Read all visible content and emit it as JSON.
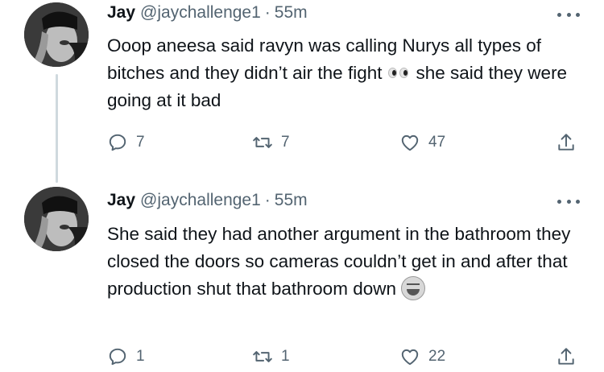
{
  "tweets": [
    {
      "author": {
        "name": "Jay",
        "handle": "@jaychallenge1"
      },
      "separator": "·",
      "time": "55m",
      "text_before_emoji": "Ooop aneesa said ravyn was calling Nurys all types of bitches and they didn’t air the fight",
      "emoji": "eyes-emoji",
      "text_after_emoji": "she said they were going at it bad",
      "stats": {
        "replies": "7",
        "retweets": "7",
        "likes": "47"
      }
    },
    {
      "author": {
        "name": "Jay",
        "handle": "@jaychallenge1"
      },
      "separator": "·",
      "time": "55m",
      "text_before_emoji": "She said they had another argument in the bathroom they closed the doors so cameras couldn’t get in and after that production shut that bathroom down",
      "emoji": "grinning-sweat-emoji",
      "text_after_emoji": "",
      "stats": {
        "replies": "1",
        "retweets": "1",
        "likes": "22"
      }
    }
  ],
  "colors": {
    "text": "#0f1419",
    "secondary": "#536471",
    "thread_line": "#cfd9de"
  },
  "icons": [
    "reply-icon",
    "retweet-icon",
    "like-icon",
    "share-icon",
    "more-icon"
  ]
}
